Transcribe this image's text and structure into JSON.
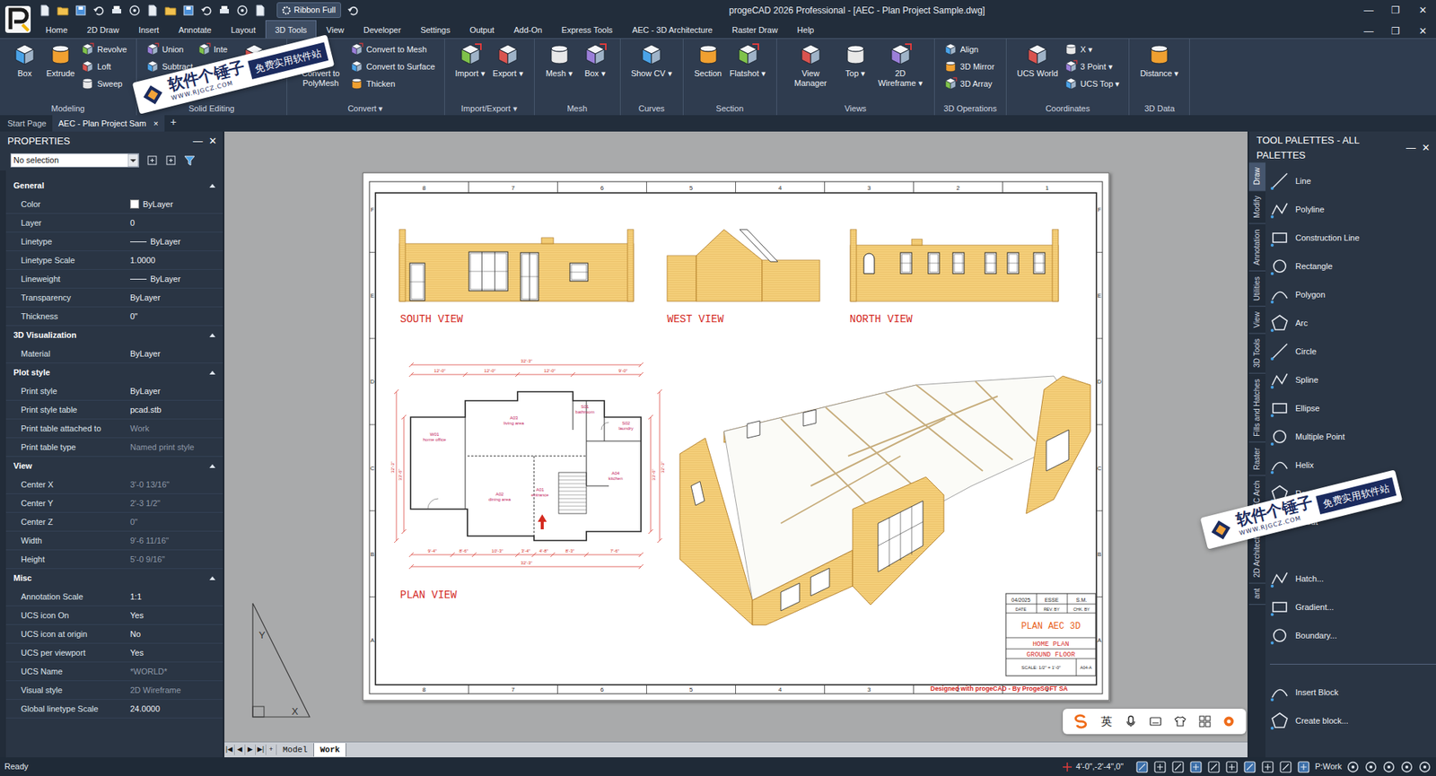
{
  "window": {
    "title": "progeCAD 2026 Professional - [AEC - Plan Project Sample.dwg]",
    "ribbon_mode": "Ribbon Full",
    "controls": [
      "—",
      "❐",
      "✕"
    ],
    "doc_controls": [
      "—",
      "❐",
      "✕"
    ]
  },
  "menu_tabs": [
    {
      "label": "Home",
      "selected": false
    },
    {
      "label": "2D Draw",
      "selected": false
    },
    {
      "label": "Insert",
      "selected": false
    },
    {
      "label": "Annotate",
      "selected": false
    },
    {
      "label": "Layout",
      "selected": false
    },
    {
      "label": "3D Tools",
      "selected": true
    },
    {
      "label": "View",
      "selected": false
    },
    {
      "label": "Developer",
      "selected": false
    },
    {
      "label": "Settings",
      "selected": false
    },
    {
      "label": "Output",
      "selected": false
    },
    {
      "label": "Add-On",
      "selected": false
    },
    {
      "label": "Express Tools",
      "selected": false
    },
    {
      "label": "AEC - 3D Architecture",
      "selected": false
    },
    {
      "label": "Raster Draw",
      "selected": false
    },
    {
      "label": "Help",
      "selected": false
    }
  ],
  "ribbon": {
    "groups": [
      {
        "title": "Modeling",
        "tools": [
          {
            "label": "Box",
            "kind": "large"
          },
          {
            "label": "Extrude",
            "kind": "large"
          },
          {
            "label": "Revolve",
            "kind": "small"
          },
          {
            "label": "Loft",
            "kind": "small"
          },
          {
            "label": "Sweep",
            "kind": "small"
          }
        ]
      },
      {
        "title": "Solid Editing",
        "tools": [
          {
            "label": "Union",
            "kind": "small"
          },
          {
            "label": "Subtract",
            "kind": "small"
          },
          {
            "label": "Slice",
            "kind": "small"
          },
          {
            "label": "Inte",
            "kind": "small"
          },
          {
            "label": "ude faces ▾",
            "kind": "large"
          }
        ]
      },
      {
        "title": "Convert ▾",
        "tools": [
          {
            "label": "Convert to PolyMesh",
            "kind": "large"
          },
          {
            "label": "Convert to Mesh",
            "kind": "small"
          },
          {
            "label": "Convert to Surface",
            "kind": "small"
          },
          {
            "label": "Thicken",
            "kind": "small"
          }
        ]
      },
      {
        "title": "Import/Export ▾",
        "tools": [
          {
            "label": "Import ▾",
            "kind": "large"
          },
          {
            "label": "Export ▾",
            "kind": "large"
          }
        ]
      },
      {
        "title": "Mesh",
        "tools": [
          {
            "label": "Mesh ▾",
            "kind": "large"
          },
          {
            "label": "Box ▾",
            "kind": "large"
          }
        ]
      },
      {
        "title": "Curves",
        "tools": [
          {
            "label": "Show CV ▾",
            "kind": "large"
          }
        ]
      },
      {
        "title": "Section",
        "tools": [
          {
            "label": "Section",
            "kind": "large"
          },
          {
            "label": "Flatshot ▾",
            "kind": "large"
          }
        ]
      },
      {
        "title": "Views",
        "tools": [
          {
            "label": "View Manager",
            "kind": "large"
          },
          {
            "label": "Top ▾",
            "kind": "large"
          },
          {
            "label": "2D Wireframe ▾",
            "kind": "large"
          }
        ]
      },
      {
        "title": "3D Operations",
        "tools": [
          {
            "label": "Align",
            "kind": "small"
          },
          {
            "label": "3D Mirror",
            "kind": "small"
          },
          {
            "label": "3D Array",
            "kind": "small"
          }
        ]
      },
      {
        "title": "Coordinates",
        "tools": [
          {
            "label": "UCS World",
            "kind": "large"
          },
          {
            "label": "X ▾",
            "kind": "small"
          },
          {
            "label": "3 Point ▾",
            "kind": "small"
          },
          {
            "label": "UCS Top ▾",
            "kind": "small"
          }
        ]
      },
      {
        "title": "3D Data",
        "tools": [
          {
            "label": "Distance ▾",
            "kind": "large"
          }
        ]
      }
    ]
  },
  "doc_tabs": {
    "tabs": [
      {
        "label": "Start Page",
        "selected": false
      },
      {
        "label": "AEC - Plan Project Sam",
        "selected": true
      }
    ],
    "close": "×",
    "add": "+"
  },
  "properties": {
    "title": "PROPERTIES",
    "pin": "—",
    "close": "✕",
    "selection": "No selection",
    "sections": [
      {
        "title": "General",
        "expanded": true,
        "rows": [
          {
            "name": "Color",
            "value": "ByLayer",
            "kind": "swatch",
            "disabled": false
          },
          {
            "name": "Layer",
            "value": "0",
            "kind": "text",
            "disabled": false
          },
          {
            "name": "Linetype",
            "value": "ByLayer",
            "kind": "line",
            "disabled": false
          },
          {
            "name": "Linetype Scale",
            "value": "1.0000",
            "kind": "text",
            "disabled": false
          },
          {
            "name": "Lineweight",
            "value": "ByLayer",
            "kind": "line",
            "disabled": false
          },
          {
            "name": "Transparency",
            "value": "ByLayer",
            "kind": "text",
            "disabled": false
          },
          {
            "name": "Thickness",
            "value": "0\"",
            "kind": "text",
            "disabled": false
          }
        ]
      },
      {
        "title": "3D Visualization",
        "expanded": true,
        "rows": [
          {
            "name": "Material",
            "value": "ByLayer",
            "kind": "text",
            "disabled": false
          }
        ]
      },
      {
        "title": "Plot style",
        "expanded": true,
        "rows": [
          {
            "name": "Print style",
            "value": "ByLayer",
            "kind": "text",
            "disabled": false
          },
          {
            "name": "Print style table",
            "value": "pcad.stb",
            "kind": "text",
            "disabled": false
          },
          {
            "name": "Print table attached to",
            "value": "Work",
            "kind": "text",
            "disabled": true
          },
          {
            "name": "Print table type",
            "value": "Named print style",
            "kind": "text",
            "disabled": true
          }
        ]
      },
      {
        "title": "View",
        "expanded": true,
        "rows": [
          {
            "name": "Center X",
            "value": "3'-0 13/16\"",
            "kind": "text",
            "disabled": true
          },
          {
            "name": "Center Y",
            "value": "2'-3 1/2\"",
            "kind": "text",
            "disabled": true
          },
          {
            "name": "Center Z",
            "value": "0\"",
            "kind": "text",
            "disabled": true
          },
          {
            "name": "Width",
            "value": "9'-6 11/16\"",
            "kind": "text",
            "disabled": true
          },
          {
            "name": "Height",
            "value": "5'-0 9/16\"",
            "kind": "text",
            "disabled": true
          }
        ]
      },
      {
        "title": "Misc",
        "expanded": true,
        "rows": [
          {
            "name": "Annotation Scale",
            "value": "1:1",
            "kind": "text",
            "disabled": false
          },
          {
            "name": "UCS icon On",
            "value": "Yes",
            "kind": "text",
            "disabled": false
          },
          {
            "name": "UCS icon at origin",
            "value": "No",
            "kind": "text",
            "disabled": false
          },
          {
            "name": "UCS per viewport",
            "value": "Yes",
            "kind": "text",
            "disabled": false
          },
          {
            "name": "UCS Name",
            "value": "*WORLD*",
            "kind": "text",
            "disabled": true
          },
          {
            "name": "Visual style",
            "value": "2D Wireframe",
            "kind": "text",
            "disabled": true
          },
          {
            "name": "Global linetype Scale",
            "value": "24.0000",
            "kind": "text",
            "disabled": false
          }
        ]
      }
    ]
  },
  "drawing": {
    "columns": [
      "8",
      "7",
      "6",
      "5",
      "4",
      "3",
      "2",
      "1"
    ],
    "rows": [
      "F",
      "E",
      "D",
      "C",
      "B",
      "A"
    ],
    "views": [
      {
        "label": "SOUTH VIEW"
      },
      {
        "label": "WEST VIEW"
      },
      {
        "label": "NORTH VIEW"
      }
    ],
    "plan": {
      "label": "PLAN VIEW",
      "rooms": [
        {
          "code": "W01",
          "name": "home office"
        },
        {
          "code": "A03",
          "name": "living area"
        },
        {
          "code": "S01",
          "name": "bathroom"
        },
        {
          "code": "S02",
          "name": "laundry"
        },
        {
          "code": "A02",
          "name": "dining area"
        },
        {
          "code": "A01",
          "name": "entrance"
        },
        {
          "code": "A04",
          "name": "kitchen"
        }
      ],
      "dims_top": "32'-3\"",
      "dims_second": [
        "12'-0\"",
        "12'-0\"",
        "12'-0\"",
        "9'-0\""
      ],
      "dims_bottom": [
        "9'-4\"",
        "8'-6\"",
        "10'-3\"",
        "3'-4\"",
        "4'-8\"",
        "8'-3\"",
        "7'-6\""
      ],
      "dims_total": "32'-3\"",
      "dims_left": [
        "32'-3\"",
        "33'-6\""
      ],
      "dims_right": [
        "33'-6\"",
        "32'-3\""
      ]
    },
    "title_block": {
      "date": "04/2025",
      "rev_by": "ESSE",
      "chk_by": "S.M.",
      "date_label": "DATE",
      "rev_label": "REV. BY",
      "chk_label": "CHK. BY",
      "project": "PLAN AEC 3D",
      "title": "HOME PLAN",
      "subtitle": "GROUND FLOOR",
      "scale": "SCALE: 1/2\" = 1'-0\"",
      "sheet": "A04-A"
    },
    "credit": "Designed with progeCAD - By ProgeSOFT SA"
  },
  "ucs_icon": {
    "x": "X",
    "y": "Y"
  },
  "layout_tabs": {
    "nav": [
      "|◀",
      "◀",
      "▶",
      "▶|",
      "+"
    ],
    "tabs": [
      {
        "label": "Model",
        "selected": false
      },
      {
        "label": "Work",
        "selected": true
      }
    ]
  },
  "tool_palettes": {
    "title": "TOOL PALETTES - ALL PALETTES",
    "pin": "—",
    "close": "✕",
    "tabs": [
      {
        "label": "Draw",
        "selected": true
      },
      {
        "label": "Modify",
        "selected": false
      },
      {
        "label": "Annotation",
        "selected": false
      },
      {
        "label": "Utilities",
        "selected": false
      },
      {
        "label": "View",
        "selected": false
      },
      {
        "label": "3D Tools",
        "selected": false
      },
      {
        "label": "Fills and Hatches",
        "selected": false
      },
      {
        "label": "Raster",
        "selected": false
      },
      {
        "label": "AEC Arch",
        "selected": false
      },
      {
        "label": "2D Architectural",
        "selected": false
      },
      {
        "label": "ant",
        "selected": false
      }
    ],
    "sections": [
      [
        "Line",
        "Polyline",
        "Construction Line",
        "Rectangle",
        "Polygon",
        "Arc",
        "Circle",
        "Spline",
        "Ellipse",
        "Multiple Point",
        "Helix",
        "Revision Cloud",
        "ipeout"
      ],
      [
        "Hatch...",
        "Gradient...",
        "Boundary..."
      ],
      [
        "Insert Block",
        "Create block..."
      ]
    ]
  },
  "ime_bar": {
    "label": "英"
  },
  "watermarks": [
    {
      "title": "软件个锤子",
      "subtitle": "免费实用软件站",
      "url": "WWW.RJGCZ.COM"
    },
    {
      "title": "软件个锤子",
      "subtitle": "免费实用软件站",
      "url": "WWW.RJGCZ.COM"
    }
  ],
  "status_bar": {
    "text": "Ready",
    "coords": "4'-0\",-2'-4\",0\"",
    "space": "P:Work"
  }
}
